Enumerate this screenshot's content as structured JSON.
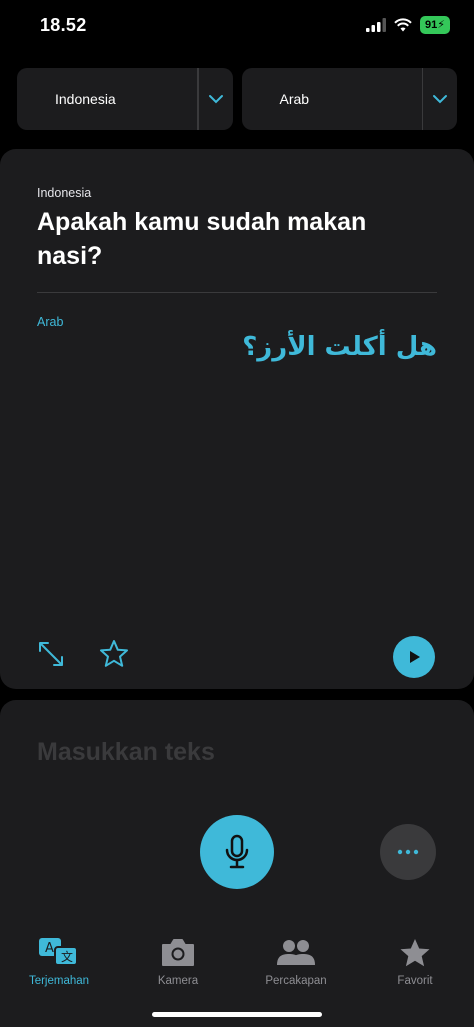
{
  "status_bar": {
    "time": "18.52",
    "battery": "91"
  },
  "languages": {
    "source": "Indonesia",
    "target": "Arab"
  },
  "result": {
    "source_label": "Indonesia",
    "source_text": "Apakah kamu sudah makan nasi?",
    "target_label": "Arab",
    "target_text": "هل أكلت الأرز؟"
  },
  "input": {
    "placeholder": "Masukkan teks"
  },
  "tabs": [
    {
      "label": "Terjemahan",
      "icon": "translate-icon",
      "active": true
    },
    {
      "label": "Kamera",
      "icon": "camera-icon",
      "active": false
    },
    {
      "label": "Percakapan",
      "icon": "people-icon",
      "active": false
    },
    {
      "label": "Favorit",
      "icon": "star-icon",
      "active": false
    }
  ],
  "colors": {
    "accent": "#3fb9d9",
    "background": "#000000",
    "card": "#1c1c1e",
    "battery": "#34c759"
  }
}
